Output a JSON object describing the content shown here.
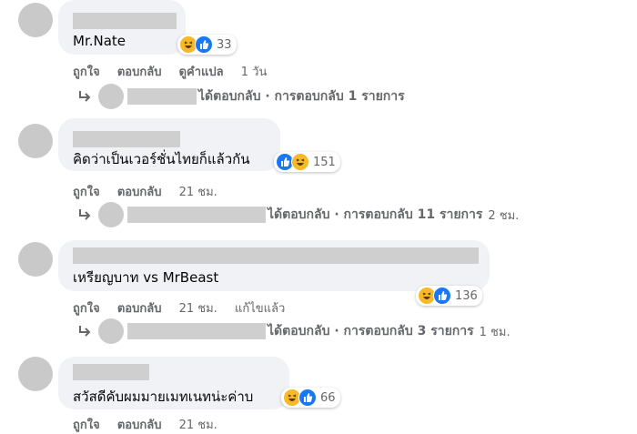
{
  "comments": [
    {
      "text": "Mr.Nate",
      "reaction_count": "33",
      "like_label": "ถูกใจ",
      "reply_label": "ตอบกลับ",
      "translate_label": "ดูคำแปล",
      "time": "1 วัน",
      "replies": {
        "summary": "ได้ตอบกลับ · การตอบกลับ 1 รายการ",
        "time": ""
      }
    },
    {
      "text": "คิดว่าเป็นเวอร์ชั่นไทยก็แล้วกัน",
      "reaction_count": "151",
      "like_label": "ถูกใจ",
      "reply_label": "ตอบกลับ",
      "time": "21 ชม.",
      "replies": {
        "summary": "ได้ตอบกลับ · การตอบกลับ 11 รายการ",
        "time": "2 ชม."
      }
    },
    {
      "text": "เหรียญบาท vs MrBeast",
      "reaction_count": "136",
      "like_label": "ถูกใจ",
      "reply_label": "ตอบกลับ",
      "time": "21 ชม.",
      "edited": "แก้ไขแล้ว",
      "replies": {
        "summary": "ได้ตอบกลับ · การตอบกลับ 3 รายการ",
        "time": "1 ชม."
      }
    },
    {
      "text": "สวัสดีคับผมมายเมทเนทน่ะค่าบ",
      "reaction_count": "66",
      "like_label": "ถูกใจ",
      "reply_label": "ตอบกลับ",
      "time": "21 ชม."
    }
  ],
  "colors": {
    "bubble": "#f0f2f5",
    "redaction": "#cfcfcf",
    "like_blue": "#1877f2",
    "haha_yellow": "#f7b928",
    "secondary_text": "#65676b"
  },
  "icons": [
    "haha-reaction-icon",
    "like-reaction-icon",
    "reply-arrow-icon"
  ]
}
